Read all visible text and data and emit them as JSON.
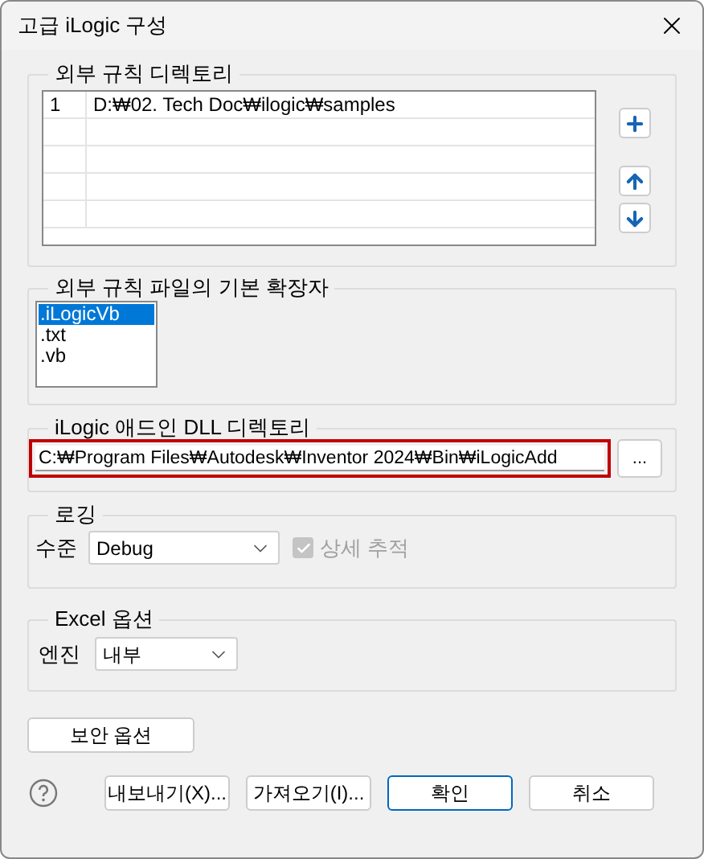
{
  "window": {
    "title": "고급 iLogic 구성"
  },
  "rules_directories": {
    "label": "외부 규칙 디렉토리",
    "rows": [
      {
        "index": "1",
        "path": "D:₩02. Tech Doc₩ilogic₩samples"
      }
    ]
  },
  "extensions": {
    "label": "외부 규칙 파일의 기본 확장자",
    "items": [
      {
        "label": ".iLogicVb",
        "selected": true
      },
      {
        "label": ".txt",
        "selected": false
      },
      {
        "label": ".vb",
        "selected": false
      }
    ]
  },
  "dll_directory": {
    "label": "iLogic 애드인 DLL 디렉토리",
    "value": "C:₩Program Files₩Autodesk₩Inventor 2024₩Bin₩iLogicAdd",
    "highlighted": true,
    "browse": "..."
  },
  "logging": {
    "label": "로깅",
    "level_label": "수준",
    "level": "Debug",
    "detail": {
      "label": "상세 추적",
      "checked": true,
      "disabled": true
    }
  },
  "excel": {
    "label": "Excel 옵션",
    "engine_label": "엔진",
    "engine": "내부"
  },
  "security_button": "보안 옵션",
  "buttons": [
    {
      "label": "내보내기(X)...",
      "default": false
    },
    {
      "label": "가져오기(I)...",
      "default": false
    },
    {
      "label": "확인",
      "default": true
    },
    {
      "label": "취소",
      "default": false
    }
  ]
}
